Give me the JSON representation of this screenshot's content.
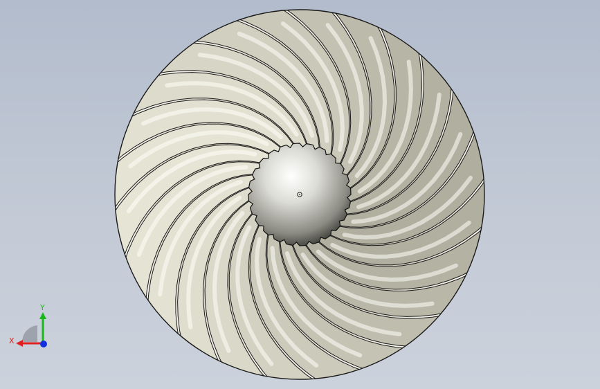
{
  "viewport": {
    "background_top": "#b2bccc",
    "background_bottom": "#ccd2dc"
  },
  "model": {
    "part": "axial-fan-impeller",
    "blade_count": 24,
    "blade_color": "#f1f0e4",
    "blade_shadow_color": "#6e6c5c",
    "hub_color": "#c9c9c9",
    "edge_color": "#1a1a1a"
  },
  "triad": {
    "x_label": "X",
    "y_label": "Y",
    "x_color": "#e02020",
    "y_color": "#18b818",
    "z_color": "#1030e0"
  }
}
